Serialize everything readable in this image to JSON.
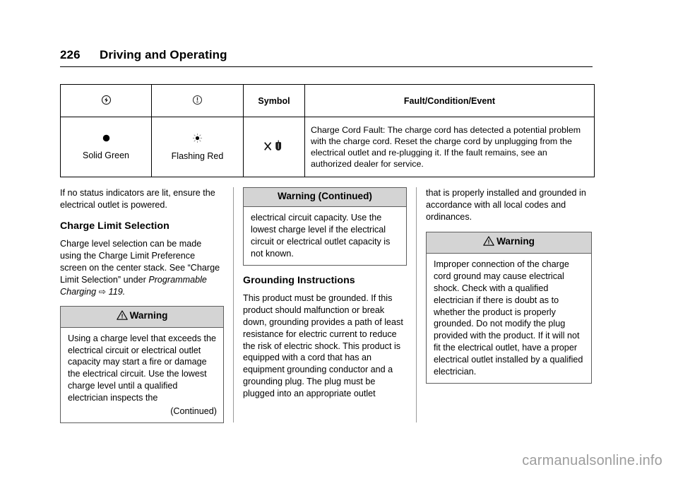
{
  "header": {
    "page_number": "226",
    "title": "Driving and Operating"
  },
  "status_table": {
    "headers": {
      "col1_icon": "charging-bolt-circle-icon",
      "col2_icon": "exclamation-circle-icon",
      "col3_label": "Symbol",
      "col4_label": "Fault/Condition/Event"
    },
    "rows": [
      {
        "indicator1_icon": "solid-dot-icon",
        "indicator1_label": "Solid Green",
        "indicator2_icon": "flashing-dot-icon",
        "indicator2_label": "Flashing Red",
        "symbol_icon": "x-charge-plug-icon",
        "description": "Charge Cord Fault: The charge cord has detected a potential problem with the charge cord. Reset the charge cord by unplugging from the electrical outlet and re-plugging it. If the fault remains, see an authorized dealer for service."
      }
    ]
  },
  "left_column": {
    "intro_paragraph": "If no status indicators are lit, ensure the electrical outlet is powered.",
    "section_heading": "Charge Limit Selection",
    "body_paragraph_part1": "Charge level selection can be made using the Charge Limit Preference screen on the center stack. See “Charge Limit Selection” under ",
    "cross_reference": "Programmable Charging",
    "cross_reference_arrow": "⇨",
    "cross_reference_page": "119",
    "cross_reference_suffix": ".",
    "warning": {
      "title": "Warning",
      "icon": "warning-triangle-icon",
      "body": "Using a charge level that exceeds the electrical circuit or electrical outlet capacity may start a fire or damage the electrical circuit. Use the lowest charge level until a qualified electrician inspects the",
      "continued": "(Continued)"
    }
  },
  "middle_column": {
    "warning_continued": {
      "title": "Warning  (Continued)",
      "body": "electrical circuit capacity. Use the lowest charge level if the electrical circuit or electrical outlet capacity is not known."
    },
    "section_heading": "Grounding Instructions",
    "body_paragraph": "This product must be grounded. If this product should malfunction or break down, grounding provides a path of least resistance for electric current to reduce the risk of electric shock. This product is equipped with a cord that has an equipment grounding conductor and a grounding plug. The plug must be plugged into an appropriate outlet"
  },
  "right_column": {
    "continuation_paragraph": "that is properly installed and grounded in accordance with all local codes and ordinances.",
    "warning": {
      "title": "Warning",
      "icon": "warning-triangle-icon",
      "body": "Improper connection of the charge cord ground may cause electrical shock. Check with a qualified electrician if there is doubt as to whether the product is properly grounded. Do not modify the plug provided with the product. If it will not fit the electrical outlet, have a proper electrical outlet installed by a qualified electrician."
    }
  },
  "footer": {
    "watermark": "carmanualsonline.info"
  }
}
